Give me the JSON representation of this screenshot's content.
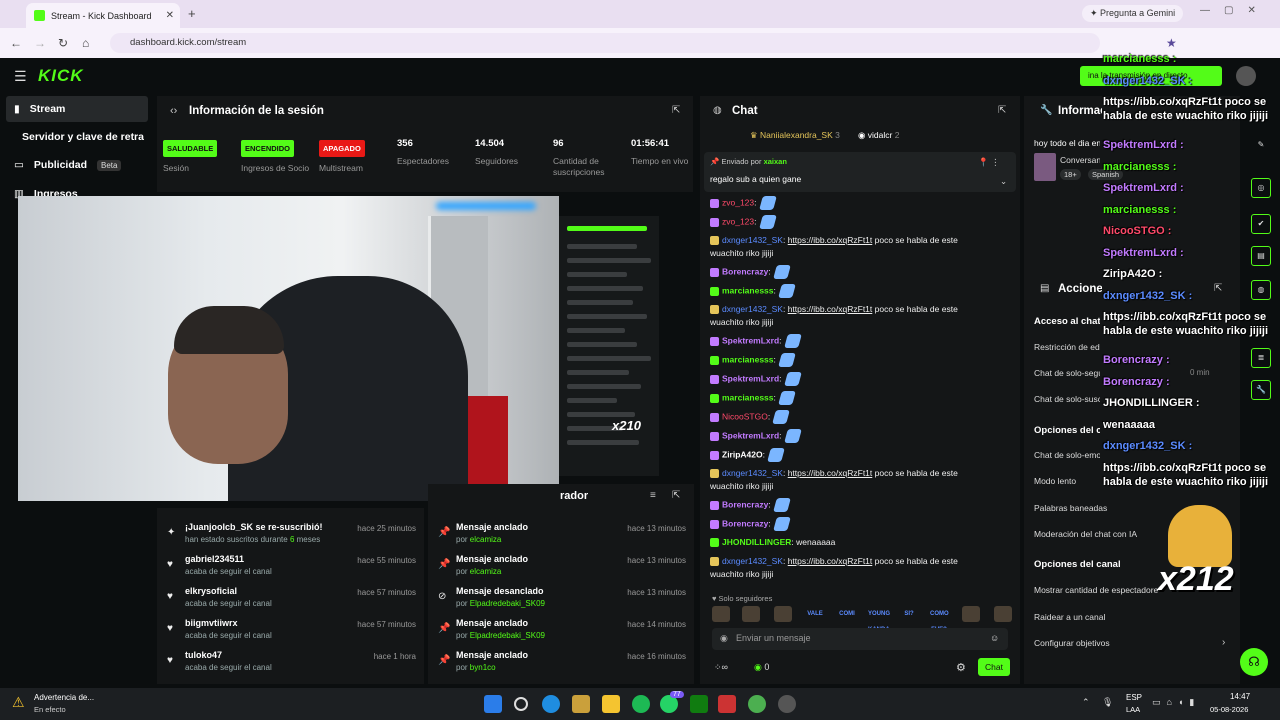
{
  "browser": {
    "tab_title": "Stream - Kick Dashboard",
    "tab_close": "✕",
    "new_tab": "+",
    "gemini_label": "Pregunta a Gemini",
    "url": "dashboard.kick.com/stream"
  },
  "kick": {
    "logo": "KICK",
    "sidebar": [
      {
        "label": "Stream"
      },
      {
        "label": "Servidor y clave de retransmisión"
      },
      {
        "label": "Publicidad",
        "badge": "Beta"
      },
      {
        "label": "Ingresos"
      }
    ]
  },
  "session": {
    "title": "Información de la sesión",
    "stats": [
      {
        "pill": "SALUDABLE",
        "label": "Sesión",
        "color": "#53fc18"
      },
      {
        "pill": "ENCENDIDO",
        "label": "Ingresos de Socio",
        "color": "#53fc18"
      },
      {
        "pill": "APAGADO",
        "label": "Multistream",
        "color": "#e91916"
      },
      {
        "value": "356",
        "label": "Espectadores"
      },
      {
        "value": "14.504",
        "label": "Seguidores"
      },
      {
        "value": "96",
        "label": "Cantidad de suscripciones"
      },
      {
        "value": "01:56:41",
        "label": "Tiempo en vivo"
      }
    ]
  },
  "webcam": {
    "overlay_count": "x210"
  },
  "feed_left": [
    {
      "icon": "star",
      "name": "¡Juanjoolcb_SK se re-suscribió!",
      "sub_prefix": "han estado suscritos durante ",
      "sub_highlight": "6",
      "sub_suffix": " meses",
      "time": "hace 25 minutos"
    },
    {
      "icon": "heart",
      "name": "gabriel234511",
      "sub": "acaba de seguir el canal",
      "time": "hace 55 minutos"
    },
    {
      "icon": "heart",
      "name": "elkrysoficial",
      "sub": "acaba de seguir el canal",
      "time": "hace 57 minutos"
    },
    {
      "icon": "heart",
      "name": "biigmvtiiwrx",
      "sub": "acaba de seguir el canal",
      "time": "hace 57 minutos"
    },
    {
      "icon": "heart",
      "name": "tuloko47",
      "sub": "acaba de seguir el canal",
      "time": "hace 1 hora"
    }
  ],
  "feed_right": {
    "title_fragment": "rador",
    "items": [
      {
        "icon": "pin",
        "name": "Mensaje anclado",
        "by_prefix": "por ",
        "by": "elcamiza",
        "time": "hace 13 minutos"
      },
      {
        "icon": "pin",
        "name": "Mensaje anclado",
        "by_prefix": "por ",
        "by": "elcamiza",
        "time": "hace 13 minutos"
      },
      {
        "icon": "unpin",
        "name": "Mensaje desanclado",
        "by_prefix": "por ",
        "by": "Elpadredebaki_SK09",
        "time": "hace 13 minutos"
      },
      {
        "icon": "pin",
        "name": "Mensaje anclado",
        "by_prefix": "por ",
        "by": "Elpadredebaki_SK09",
        "time": "hace 14 minutos"
      },
      {
        "icon": "pin",
        "name": "Mensaje anclado",
        "by_prefix": "por ",
        "by": "byn1co",
        "time": "hace 16 minutos"
      }
    ]
  },
  "chat": {
    "title": "Chat",
    "top_users": [
      {
        "name": "Naniialexandra_SK",
        "count": "3"
      },
      {
        "name": "vidalcr",
        "count": "2"
      }
    ],
    "pinned": {
      "label": "Enviado por",
      "user": "xaixan",
      "text": "regalo sub a quien gane"
    },
    "messages": [
      {
        "user": "zvo_123",
        "cls": "u-red",
        "text": ":"
      },
      {
        "user": "zvo_123",
        "cls": "u-red",
        "text": ":"
      },
      {
        "user": "dxnger1432_SK",
        "cls": "u-blue",
        "text": ": ",
        "link": "https://ibb.co/xqRzFt1t",
        "after": " poco se habla de este wuachito riko jijiji"
      },
      {
        "user": "Borencrazy",
        "cls": "u-purple",
        "text": ":"
      },
      {
        "user": "marcianesss",
        "cls": "u-green",
        "text": ":"
      },
      {
        "user": "dxnger1432_SK",
        "cls": "u-blue",
        "text": ": ",
        "link": "https://ibb.co/xqRzFt1t",
        "after": " poco se habla de este wuachito riko jijiji"
      },
      {
        "user": "SpektremLxrd",
        "cls": "u-purple",
        "text": ":"
      },
      {
        "user": "marcianesss",
        "cls": "u-green",
        "text": ":"
      },
      {
        "user": "SpektremLxrd",
        "cls": "u-purple",
        "text": ":"
      },
      {
        "user": "marcianesss",
        "cls": "u-green",
        "text": ":"
      },
      {
        "user": "NicooSTGO",
        "cls": "u-red",
        "text": ":"
      },
      {
        "user": "SpektremLxrd",
        "cls": "u-purple",
        "text": ":"
      },
      {
        "user": "ZiripA42O",
        "cls": "u-white",
        "text": ":"
      },
      {
        "user": "dxnger1432_SK",
        "cls": "u-blue",
        "text": ": ",
        "link": "https://ibb.co/xqRzFt1t",
        "after": " poco se habla de este wuachito riko jijiji"
      },
      {
        "user": "Borencrazy",
        "cls": "u-purple",
        "text": ":"
      },
      {
        "user": "Borencrazy",
        "cls": "u-purple",
        "text": ":"
      },
      {
        "user": "JHONDILLINGER",
        "cls": "u-green",
        "text": ": wenaaaaa"
      },
      {
        "user": "dxnger1432_SK",
        "cls": "u-blue",
        "text": ": ",
        "link": "https://ibb.co/xqRzFt1t",
        "after": " poco se habla de este wuachito riko jijiji"
      }
    ],
    "followers_only": "Solo seguidores",
    "emote_labels": [
      "VALE",
      "COMI",
      "YOUNG KANDA",
      "SI?",
      "COMO FUE?"
    ],
    "input_placeholder": "Enviar un mensaje",
    "points": "0",
    "send_label": "Chat"
  },
  "right_panel": {
    "title": "Información del stream",
    "stream_title": "hoy todo el dia en vivo",
    "category": "Conversando",
    "tags": [
      "18+",
      "Spanish"
    ],
    "mod_title": "Acciones de moderador",
    "access_title": "Acceso al chat",
    "access_items": [
      "Restricción de edad",
      "Chat de solo-seguidores",
      "Chat de solo-suscriptores"
    ],
    "followers_time": "0 min",
    "chat_options_title": "Opciones del chat",
    "chat_options": [
      "Chat de solo-emotes",
      "Modo lento",
      "Palabras baneadas",
      "Moderación del chat con IA"
    ],
    "channel_options_title": "Opciones del canal",
    "channel_options": [
      "Mostrar cantidad de espectadores",
      "Raidear a un canal",
      "Configurar objetivos"
    ]
  },
  "overlay": {
    "lines": [
      {
        "text": "marcianesss :",
        "cls": "ov-g"
      },
      {
        "text": "dxnger1432_SK :",
        "cls": "ov-b"
      },
      {
        "text": "https://ibb.co/xqRzFt1t poco se habla de este wuachito riko jijiji",
        "cls": "ov-w"
      },
      {
        "text": "SpektremLxrd :",
        "cls": "ov-p"
      },
      {
        "text": "marcianesss :",
        "cls": "ov-g"
      },
      {
        "text": "SpektremLxrd :",
        "cls": "ov-p"
      },
      {
        "text": "marcianesss :",
        "cls": "ov-g"
      },
      {
        "text": "NicooSTGO :",
        "cls": "ov-r"
      },
      {
        "text": "SpektremLxrd :",
        "cls": "ov-p"
      },
      {
        "text": "ZiripA42O :",
        "cls": "ov-w"
      },
      {
        "text": "dxnger1432_SK :",
        "cls": "ov-b"
      },
      {
        "text": "https://ibb.co/xqRzFt1t poco se habla de este wuachito riko jijiji",
        "cls": "ov-w"
      },
      {
        "text": "Borencrazy :",
        "cls": "ov-p"
      },
      {
        "text": "Borencrazy :",
        "cls": "ov-p"
      },
      {
        "text": "JHONDILLINGER :",
        "cls": "ov-w"
      },
      {
        "text": "wenaaaaa",
        "cls": "ov-w"
      },
      {
        "text": "dxnger1432_SK :",
        "cls": "ov-b"
      },
      {
        "text": "https://ibb.co/xqRzFt1t poco se habla de este wuachito riko jijiji",
        "cls": "ov-w"
      }
    ],
    "count": "x212",
    "end_stream": "ina la transmisión en directo"
  },
  "taskbar": {
    "warning_title": "Advertencia de...",
    "warning_sub": "En efecto",
    "lang": "ESP",
    "lang_sub": "LAA",
    "time": "14:47",
    "date": "05-08-2026",
    "notif_count": "77"
  }
}
